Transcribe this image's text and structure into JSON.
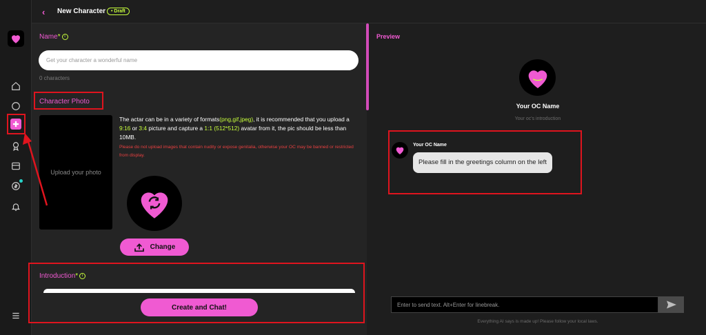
{
  "topbar": {
    "back_icon": "chevron-left-icon",
    "title": "New Character",
    "badge": "• Draft"
  },
  "sidebar": {
    "items": [
      {
        "icon": "home-icon"
      },
      {
        "icon": "chat-icon"
      },
      {
        "icon": "plus-square-icon",
        "active": true
      },
      {
        "icon": "award-icon"
      },
      {
        "icon": "card-icon"
      },
      {
        "icon": "coin-icon",
        "notify": true
      },
      {
        "icon": "bell-icon"
      },
      {
        "icon": "menu-icon"
      }
    ]
  },
  "form": {
    "name_label": "Name",
    "required_mark": "*",
    "name_placeholder": "Get your character a wonderful name",
    "name_counter": "0 characters",
    "photo_label": "Character Photo",
    "upload_label": "Upload your photo",
    "desc_part1": "The actar can be in a variety of formats",
    "desc_formats": "(png,gif,jpeg)",
    "desc_part2": ", it is recommended that you upload a ",
    "desc_ratio1": "9:16",
    "desc_or": " or ",
    "desc_ratio2": "3:4",
    "desc_part3": " picture and capture a ",
    "desc_ratio3": "1:1 (512*512)",
    "desc_part4": " avatar from it, the pic should be less than 10MB.",
    "warning": "Please do not upload images that contain nudity or expose genitalia, otherwise your OC may be banned or restricted from display.",
    "change_label": "Change",
    "intro_label": "Introduction",
    "create_label": "Create and Chat!"
  },
  "preview": {
    "title": "Preview",
    "oc_name": "Your OC Name",
    "oc_intro": "Your oc's introduction",
    "msg_name": "Your OC Name",
    "msg_text": "Please fill in the greetings column on the left",
    "input_placeholder": "Enter to send text. Alt+Enter for linebreak.",
    "disclaimer": "Everything AI says is made up! Please follow your local laws."
  },
  "colors": {
    "accent": "#f05ad2",
    "lime": "#c8ff3c",
    "highlight": "#e0141e",
    "warning": "#e84040"
  }
}
